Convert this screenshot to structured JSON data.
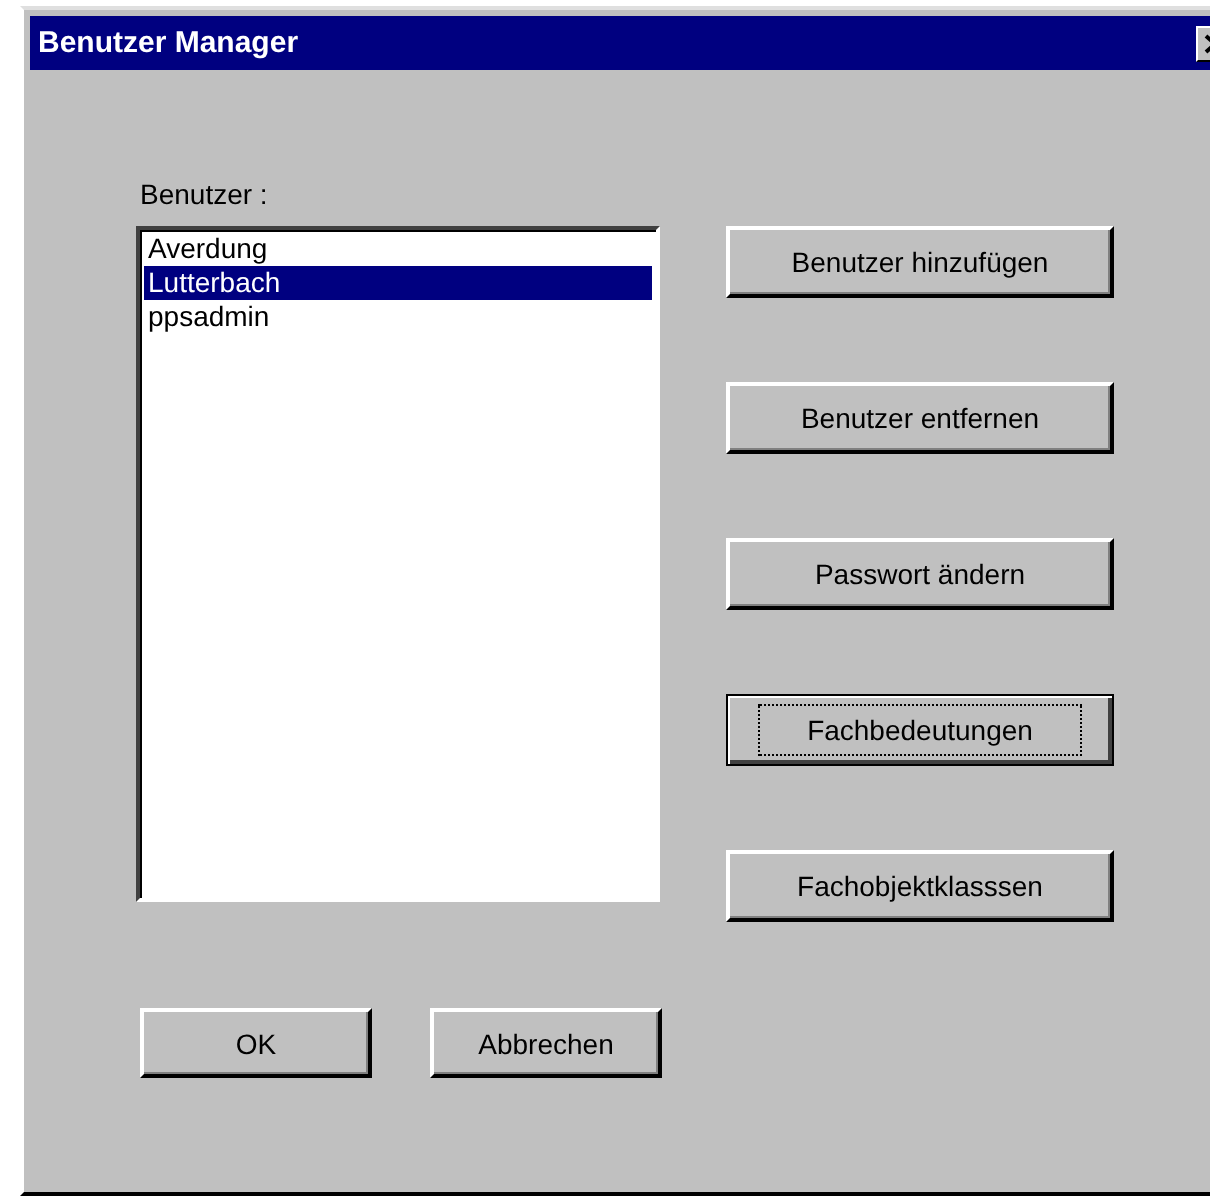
{
  "window": {
    "title": "Benutzer Manager"
  },
  "users_label": "Benutzer :",
  "users": [
    {
      "name": "Averdung",
      "selected": false
    },
    {
      "name": "Lutterbach",
      "selected": true
    },
    {
      "name": "ppsadmin",
      "selected": false
    }
  ],
  "side_buttons": [
    {
      "label": "Benutzer hinzufügen",
      "focused": false
    },
    {
      "label": "Benutzer entfernen",
      "focused": false
    },
    {
      "label": "Passwort ändern",
      "focused": false
    },
    {
      "label": "Fachbedeutungen",
      "focused": true
    },
    {
      "label": "Fachobjektklasssen",
      "focused": false
    }
  ],
  "bottom_buttons": [
    {
      "label": "OK",
      "focused": false
    },
    {
      "label": "Abbrechen",
      "focused": false
    }
  ]
}
